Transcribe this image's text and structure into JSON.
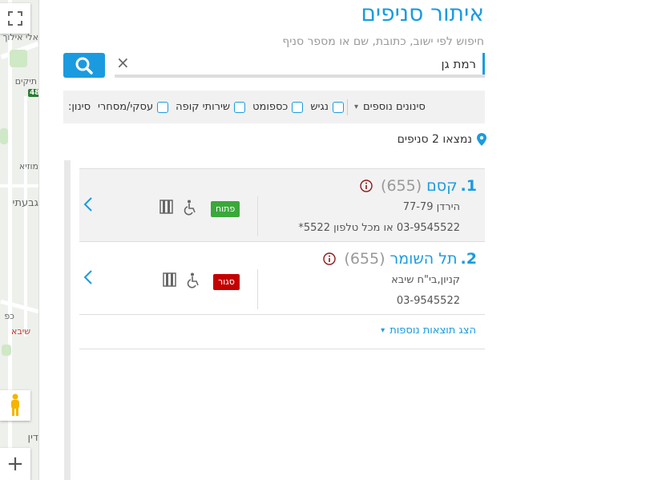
{
  "map": {
    "labels": [
      "אלי אילוך",
      "תיקים",
      "מוזיא",
      "גבעתי",
      "כפ",
      "שיבא",
      "דין"
    ],
    "route_number": "48",
    "fullscreen_icon": "fullscreen-icon",
    "pegman_icon": "pegman-icon",
    "zoom_in_label": "+"
  },
  "header": {
    "title": "איתור סניפים",
    "hint": "חיפוש לפי ישוב, כתובת, שם או מספר סניף"
  },
  "search": {
    "value": "רמת גן",
    "clear_label": "×",
    "button_icon": "search-icon"
  },
  "filters": {
    "label": "סינון:",
    "options": [
      "עסקי/מסחרי",
      "שירותי קופה",
      "כספומט",
      "נגיש"
    ],
    "more_label": "סינונים נוספים"
  },
  "results": {
    "count_text": "נמצאו 2 סניפים",
    "items": [
      {
        "number": "1.",
        "name": "קסם",
        "code": "(655)",
        "address": "הירדן 77-79",
        "phone": "03-9545522 או מכל טלפון 5522*",
        "status": "פתוח",
        "status_color": "#3aa83a"
      },
      {
        "number": "2.",
        "name": "תל השומר",
        "code": "(655)",
        "address": "קניון,בי\"ח שיבא",
        "phone": "03-9545522",
        "status": "סגור",
        "status_color": "#c40000"
      }
    ],
    "more_label": "הצג תוצאות נוספות"
  },
  "colors": {
    "accent": "#1a9be0",
    "open": "#3aa83a",
    "closed": "#c40000"
  }
}
